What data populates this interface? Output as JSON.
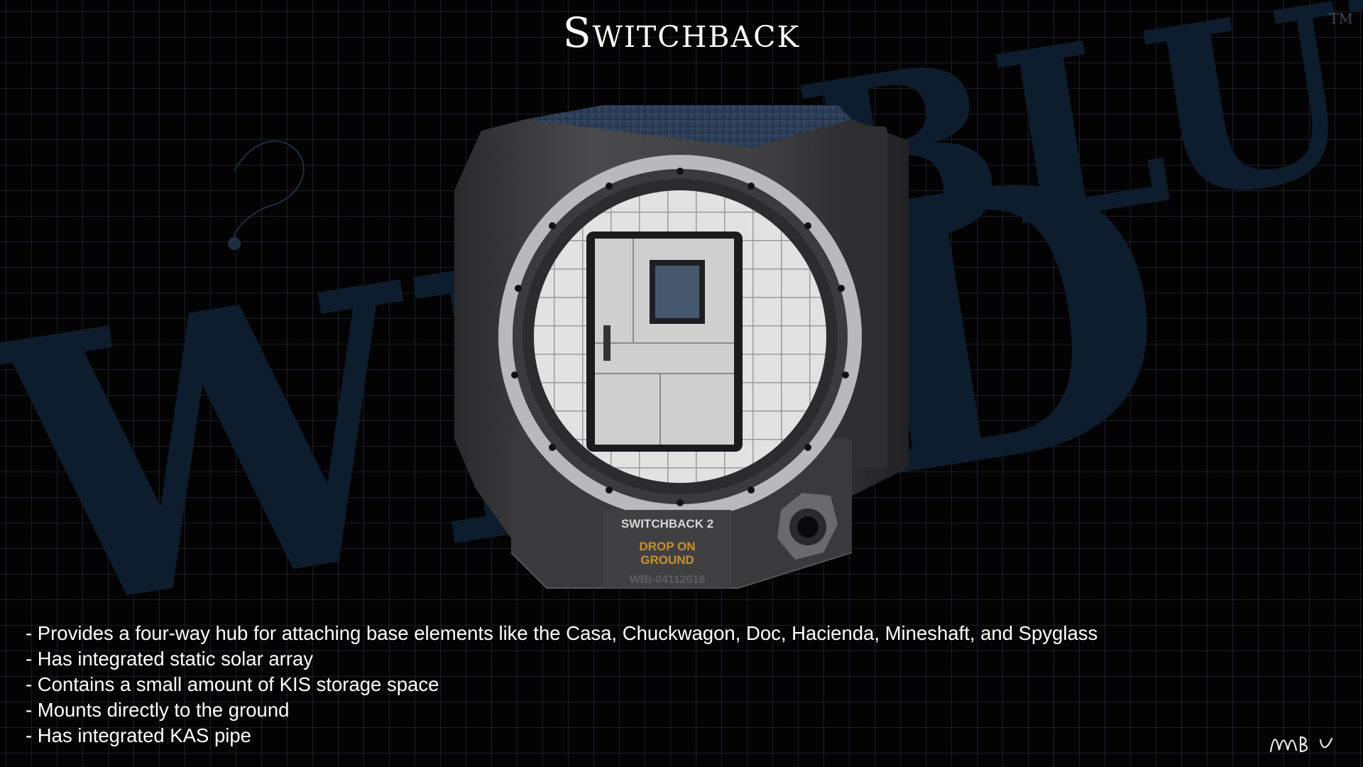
{
  "header": {
    "title": "Switchback",
    "trademark": "TM"
  },
  "watermark": {
    "text_left": "WILD",
    "text_right": "BLUE",
    "color": "#0d1d2e"
  },
  "module": {
    "label_name": "SWITCHBACK 2",
    "label_instruction_line1": "DROP ON",
    "label_instruction_line2": "GROUND",
    "label_serial": "WBI-04112016",
    "accent_color": "#c8902e",
    "solar_color": "#33455e"
  },
  "features": [
    "- Provides a four-way hub for attaching base elements like the Casa, Chuckwagon, Doc, Hacienda, Mineshaft, and Spyglass",
    "- Has integrated static solar array",
    "- Contains a small amount of KIS storage space",
    "- Mounts directly to the ground",
    "- Has integrated KAS pipe"
  ],
  "signature": {
    "text": "MWB"
  }
}
